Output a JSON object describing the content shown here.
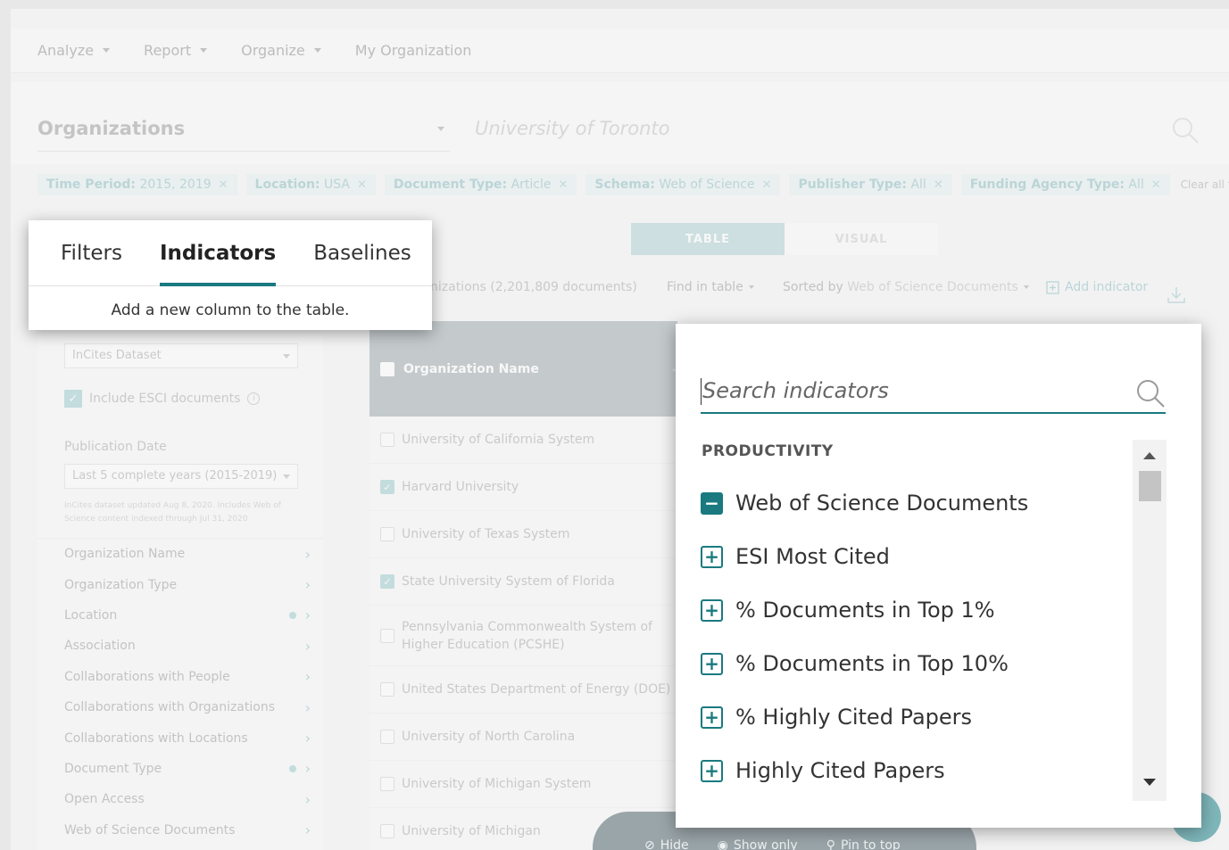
{
  "nav": {
    "items": [
      {
        "label": "Analyze",
        "has_caret": true
      },
      {
        "label": "Report",
        "has_caret": true
      },
      {
        "label": "Organize",
        "has_caret": true
      },
      {
        "label": "My Organization",
        "has_caret": false
      }
    ]
  },
  "search": {
    "entity_type": "Organizations",
    "query_placeholder": "University of Toronto"
  },
  "filters": {
    "chips": [
      {
        "key": "Time Period:",
        "value": "2015, 2019"
      },
      {
        "key": "Location:",
        "value": "USA"
      },
      {
        "key": "Document Type:",
        "value": "Article"
      },
      {
        "key": "Schema:",
        "value": "Web of Science"
      },
      {
        "key": "Publisher Type:",
        "value": "All"
      },
      {
        "key": "Funding Agency Type:",
        "value": "All"
      }
    ],
    "clear_all": "Clear all filters",
    "remove_glyph": "✕"
  },
  "view_toggle": {
    "table": "TABLE",
    "visual": "VISUAL"
  },
  "toolbar": {
    "count": "nizations (2,201,809 documents)",
    "find": "Find in table",
    "sorted_by_label": "Sorted by",
    "sorted_by_value": "Web of Science Documents",
    "add_indicator": "Add indicator"
  },
  "left_panel": {
    "dataset": "InCites Dataset",
    "esci_label": "Include ESCI documents",
    "pub_date_label": "Publication Date",
    "pub_date_value": "Last 5 complete years (2015-2019)",
    "pub_note": "InCites dataset updated Aug 8, 2020. Includes Web of Science content indexed through Jul 31, 2020",
    "filter_items": [
      {
        "label": "Organization Name",
        "dot": false
      },
      {
        "label": "Organization Type",
        "dot": false
      },
      {
        "label": "Location",
        "dot": true
      },
      {
        "label": "Association",
        "dot": false
      },
      {
        "label": "Collaborations with People",
        "dot": false
      },
      {
        "label": "Collaborations with Organizations",
        "dot": false
      },
      {
        "label": "Collaborations with Locations",
        "dot": false
      },
      {
        "label": "Document Type",
        "dot": true
      },
      {
        "label": "Open Access",
        "dot": false
      },
      {
        "label": "Web of Science Documents",
        "dot": false
      }
    ]
  },
  "table": {
    "header": "Organization Name",
    "rows": [
      {
        "name": "University of California System",
        "checked": false
      },
      {
        "name": "Harvard University",
        "checked": true
      },
      {
        "name": "University of Texas System",
        "checked": false
      },
      {
        "name": "State University System of Florida",
        "checked": true
      },
      {
        "name": "Pennsylvania Commonwealth System of Higher Education (PCSHE)",
        "checked": false
      },
      {
        "name": "United States Department of Energy (DOE)",
        "checked": false
      },
      {
        "name": "University of North Carolina",
        "checked": false
      },
      {
        "name": "University of Michigan System",
        "checked": false
      },
      {
        "name": "University of Michigan",
        "checked": false
      }
    ]
  },
  "actions": {
    "hide": "Hide",
    "show_only": "Show only",
    "pin": "Pin to top"
  },
  "tabs_popup": {
    "tabs": [
      "Filters",
      "Indicators",
      "Baselines"
    ],
    "active": "Indicators",
    "hint": "Add a new column to the table."
  },
  "indicator_popup": {
    "search_placeholder": "Search indicators",
    "section": "PRODUCTIVITY",
    "items": [
      {
        "label": "Web of Science Documents",
        "selected": true
      },
      {
        "label": "ESI Most Cited",
        "selected": false
      },
      {
        "label": "% Documents in Top 1%",
        "selected": false
      },
      {
        "label": "% Documents in Top 10%",
        "selected": false
      },
      {
        "label": "% Highly Cited Papers",
        "selected": false
      },
      {
        "label": "Highly Cited Papers",
        "selected": false
      }
    ]
  },
  "colors": {
    "accent": "#1a7a80",
    "chip_bg": "#e3eef0",
    "table_head": "#8e9ba0"
  }
}
